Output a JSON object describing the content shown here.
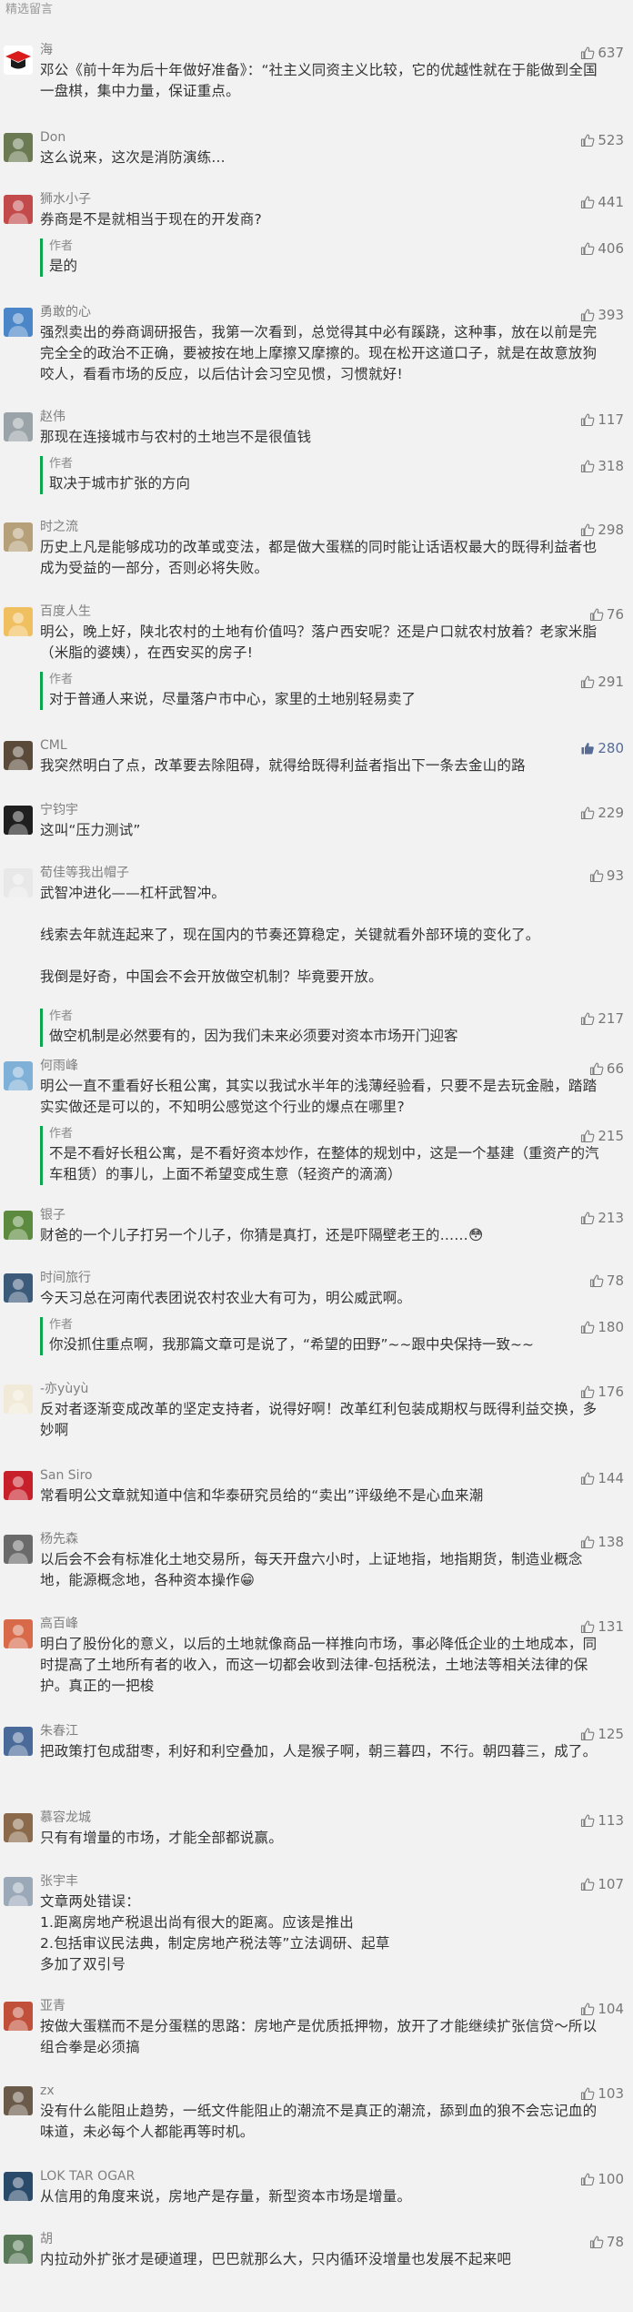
{
  "header": {
    "title": "精选留言"
  },
  "comments": [
    {
      "name": "海",
      "text": [
        "邓公《前十年为后十年做好准备》：“社主义同资主义比较，它的优越性就在于能做到全国一盘棋，集中力量，保证重点。"
      ],
      "likes": "637",
      "avatar_color": "#e01f1f",
      "avatar_icon": "graduation-cap-icon"
    },
    {
      "name": "Don",
      "text": [
        "这么说来，这次是消防演练..."
      ],
      "likes": "523",
      "avatar_color": "#6b7a52"
    },
    {
      "name": "狮水小子",
      "text": [
        "券商是不是就相当于现在的开发商?"
      ],
      "likes": "441",
      "avatar_color": "#c34a4a",
      "avatar_icon": "lion-icon",
      "reply": {
        "author": "作者",
        "text": [
          "是的"
        ],
        "likes": "406"
      }
    },
    {
      "name": "勇敢的心",
      "text": [
        "强烈卖出的券商调研报告，我第一次看到，总觉得其中必有蹊跷，这种事，放在以前是完完全全的政治不正确，要被按在地上摩擦又摩擦的。现在松开这道口子，就是在故意放狗咬人，看看市场的反应，以后估计会习空见惯，习惯就好!"
      ],
      "likes": "393",
      "avatar_color": "#4a86c8"
    },
    {
      "name": "赵伟",
      "text": [
        "那现在连接城市与农村的土地岂不是很值钱"
      ],
      "likes": "117",
      "avatar_color": "#9aa3a8",
      "reply": {
        "author": "作者",
        "text": [
          "取决于城市扩张的方向"
        ],
        "likes": "318"
      }
    },
    {
      "name": "时之流",
      "text": [
        "历史上凡是能够成功的改革或变法，都是做大蛋糕的同时能让话语权最大的既得利益者也成为受益的一部分，否则必将失败。"
      ],
      "likes": "298",
      "avatar_color": "#b6a07a"
    },
    {
      "name": "百度人生",
      "text": [
        "明公，晚上好，陕北农村的土地有价值吗？落户西安呢？还是户口就农村放着？老家米脂（米脂的婆姨），在西安买的房子!"
      ],
      "likes": "76",
      "avatar_color": "#f0c060",
      "reply": {
        "author": "作者",
        "text": [
          "对于普通人来说，尽量落户市中心，家里的土地别轻易卖了"
        ],
        "likes": "291"
      }
    },
    {
      "name": "CML",
      "text": [
        "我突然明白了点，改革要去除阻碍，就得给既得利益者指出下一条去金山的路"
      ],
      "likes": "280",
      "liked": true,
      "avatar_color": "#5a4a3a"
    },
    {
      "name": "宁钧宇",
      "text": [
        "这叫“压力测试”"
      ],
      "likes": "229",
      "avatar_color": "#1f1f1f"
    },
    {
      "name": "荀佳等我出帽子",
      "text": [
        "武智冲进化——杠杆武智冲。",
        "线索去年就连起来了，现在国内的节奏还算稳定，关键就看外部环境的变化了。",
        "我倒是好奇，中国会不会开放做空机制？毕竟要开放。"
      ],
      "likes": "93",
      "avatar_color": "#e8e8e8",
      "reply": {
        "author": "作者",
        "text": [
          "做空机制是必然要有的，因为我们未来必须要对资本市场开门迎客"
        ],
        "likes": "217"
      }
    },
    {
      "name": "何雨峰",
      "text": [
        "明公一直不重看好长租公寓，其实以我试水半年的浅薄经验看，只要不是去玩金融，踏踏实实做还是可以的，不知明公感觉这个行业的爆点在哪里?"
      ],
      "likes": "66",
      "avatar_color": "#7fb0d8",
      "reply": {
        "author": "作者",
        "text": [
          "不是不看好长租公寓，是不看好资本炒作，在整体的规划中，这是一个基建（重资产的汽车租赁）的事儿，上面不希望变成生意（轻资产的滴滴）"
        ],
        "likes": "215"
      }
    },
    {
      "name": "银子",
      "text": [
        "财爸的一个儿子打另一个儿子，你猜是真打，还是吓隔壁老王的……😳"
      ],
      "likes": "213",
      "avatar_color": "#5c8a3e"
    },
    {
      "name": "时间旅行",
      "text": [
        "今天习总在河南代表团说农村农业大有可为，明公威武啊。"
      ],
      "likes": "78",
      "avatar_color": "#3c5a7a",
      "reply": {
        "author": "作者",
        "text": [
          "你没抓住重点啊，我那篇文章可是说了，“希望的田野”~~跟中央保持一致~~"
        ],
        "likes": "180"
      }
    },
    {
      "name": "-亦yùyù",
      "text": [
        "反对者逐渐变成改革的坚定支持者，说得好啊！改革红利包装成期权与既得利益交换，多妙啊"
      ],
      "likes": "176",
      "avatar_color": "#f2ead8"
    },
    {
      "name": "San Siro",
      "text": [
        "常看明公文章就知道中信和华泰研究员给的“卖出”评级绝不是心血来潮"
      ],
      "likes": "144",
      "avatar_color": "#c8202a"
    },
    {
      "name": "杨先森",
      "text": [
        "以后会不会有标准化土地交易所，每天开盘六小时，上证地指，地指期货，制造业概念地，能源概念地，各种资本操作😁"
      ],
      "likes": "138",
      "avatar_color": "#6a6a6a"
    },
    {
      "name": "高百峰",
      "text": [
        "明白了股份化的意义，以后的土地就像商品一样推向市场，事必降低企业的土地成本，同时提高了土地所有者的收入，而这一切都会收到法律-包括税法，土地法等相关法律的保护。真正的一把梭"
      ],
      "likes": "131",
      "avatar_color": "#d86a4a"
    },
    {
      "name": "朱春江",
      "text": [
        "把政策打包成甜枣，利好和利空叠加，人是猴子啊，朝三暮四，不行。朝四暮三，成了。"
      ],
      "likes": "125",
      "avatar_color": "#4a6a9a"
    },
    {
      "name": "慕容龙城",
      "text": [
        "只有有增量的市场，才能全部都说赢。"
      ],
      "likes": "113",
      "avatar_color": "#8a6a4a"
    },
    {
      "name": "张宇丰",
      "text": [
        "文章两处错误：",
        "1.距离房地产税退出尚有很大的距离。应该是推出",
        "2.包括审议民法典，制定房地产税法等”立法调研、起草",
        "多加了双引号"
      ],
      "likes": "107",
      "avatar_color": "#9aa8b8"
    },
    {
      "name": "亚青",
      "text": [
        "按做大蛋糕而不是分蛋糕的思路：房地产是优质抵押物，放开了才能继续扩张信贷～所以组合拳是必须搞"
      ],
      "likes": "104",
      "avatar_color": "#c0503a"
    },
    {
      "name": "zx",
      "text": [
        "没有什么能阻止趋势，一纸文件能阻止的潮流不是真正的潮流，舔到血的狼不会忘记血的味道，未必每个人都能再等时机。"
      ],
      "likes": "103",
      "avatar_color": "#6a5a4a"
    },
    {
      "name": "LOK TAR OGAR",
      "text": [
        "从信用的角度来说，房地产是存量，新型资本市场是增量。"
      ],
      "likes": "100",
      "avatar_color": "#2a4a6a"
    },
    {
      "name": "胡",
      "text": [
        "内拉动外扩张才是硬道理，巴巴就那么大，只内循环没增量也发展不起来吧"
      ],
      "likes": "78",
      "avatar_color": "#5a7a5a"
    }
  ]
}
